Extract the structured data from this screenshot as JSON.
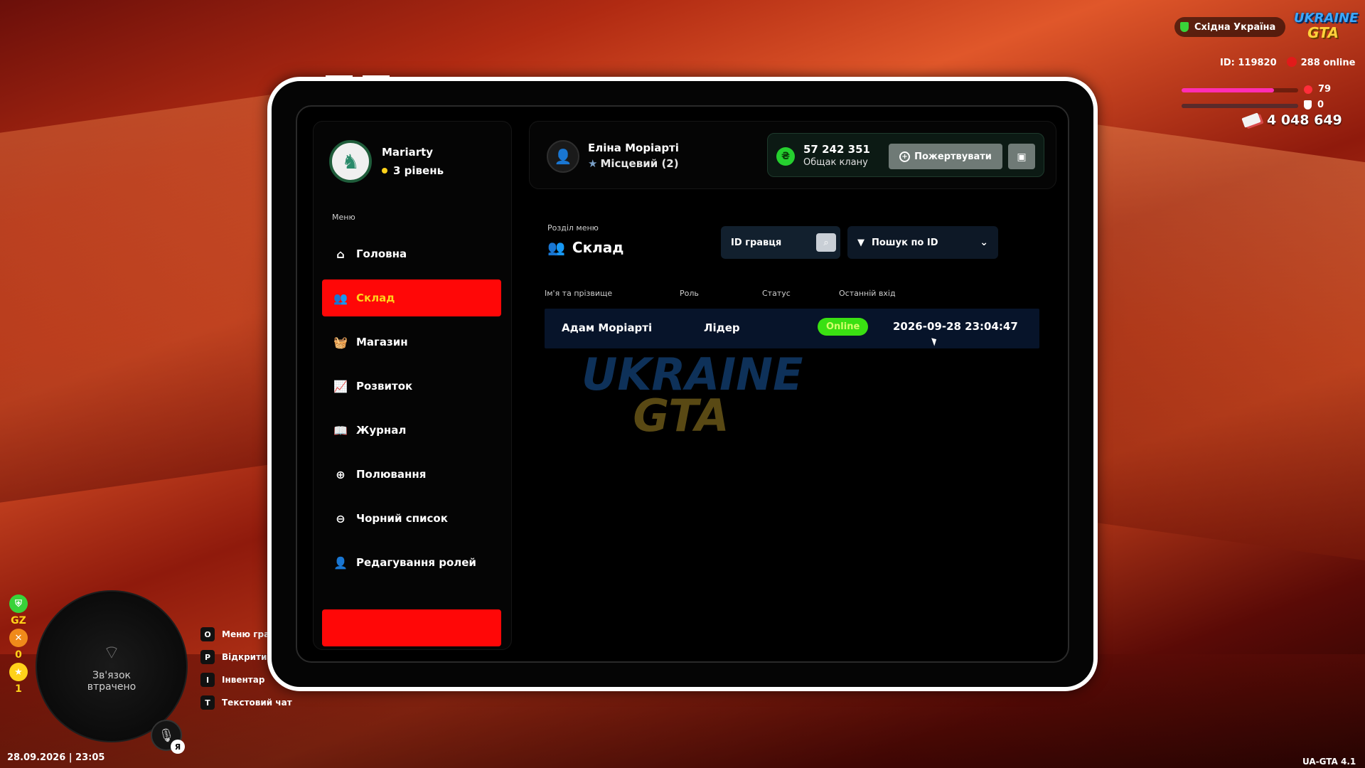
{
  "hud": {
    "server_name": "Східна Україна",
    "logo_line1": "UKRAINE",
    "logo_line2": "GTA",
    "player_id": "ID: 119820",
    "online": "288 online",
    "health": 79,
    "health_max": 100,
    "armor": 0,
    "money": "4 048 649",
    "health_color": "#ff2db4",
    "armor_color": "#5a2a2a"
  },
  "bottom_hud": {
    "side_icons": [
      {
        "icon": "shield-icon",
        "value": "GZ",
        "color": "#39d339"
      },
      {
        "icon": "tools-icon",
        "value": "0",
        "color": "#f08a1a"
      },
      {
        "icon": "star-icon",
        "value": "1",
        "color": "#ffd21a"
      }
    ],
    "minimap_status": "Зв'язок втрачено",
    "voice_key": "Я",
    "hints": [
      {
        "key": "O",
        "label": "Меню гра"
      },
      {
        "key": "P",
        "label": "Відкрити т"
      },
      {
        "key": "I",
        "label": "Інвентар"
      },
      {
        "key": "T",
        "label": "Текстовий чат"
      }
    ],
    "datetime": "28.09.2026 | 23:05",
    "version": "UA-GTA 4.1"
  },
  "sidebar": {
    "username": "Mariarty",
    "level": "3 рівень",
    "menu_caption": "Меню",
    "items": [
      {
        "label": "Головна",
        "icon": "home-icon",
        "glyph": "⌂",
        "active": false
      },
      {
        "label": "Склад",
        "icon": "group-icon",
        "glyph": "👥",
        "active": true
      },
      {
        "label": "Магазин",
        "icon": "basket-icon",
        "glyph": "🧺",
        "active": false
      },
      {
        "label": "Розвиток",
        "icon": "chart-line-icon",
        "glyph": "📈",
        "active": false
      },
      {
        "label": "Журнал",
        "icon": "book-icon",
        "glyph": "📖",
        "active": false
      },
      {
        "label": "Полювання",
        "icon": "crosshair-icon",
        "glyph": "⊕",
        "active": false
      },
      {
        "label": "Чорний список",
        "icon": "minus-circle-icon",
        "glyph": "⊖",
        "active": false
      },
      {
        "label": "Редагування ролей",
        "icon": "user-edit-icon",
        "glyph": "👤",
        "active": false
      }
    ],
    "accent_color": "#ff0707"
  },
  "header": {
    "member_name": "Еліна Моріарті",
    "member_rank": "Місцевий (2)",
    "bank_amount": "57 242 351",
    "bank_caption": "Общак клану",
    "donate_label": "Пожертвувати"
  },
  "content": {
    "section_caption": "Розділ меню",
    "section_title": "Склад",
    "id_placeholder": "ID гравця",
    "filter_label": "Пошук по ID",
    "columns": [
      "Ім'я та прізвище",
      "Роль",
      "Статус",
      "Останній вхід"
    ],
    "rows": [
      {
        "name": "Адам Моріарті",
        "role": "Лідер",
        "status": "Online",
        "last_login": "2026-09-28 23:04:47"
      }
    ],
    "watermark_line1": "UKRAINE",
    "watermark_line2": "GTA"
  }
}
